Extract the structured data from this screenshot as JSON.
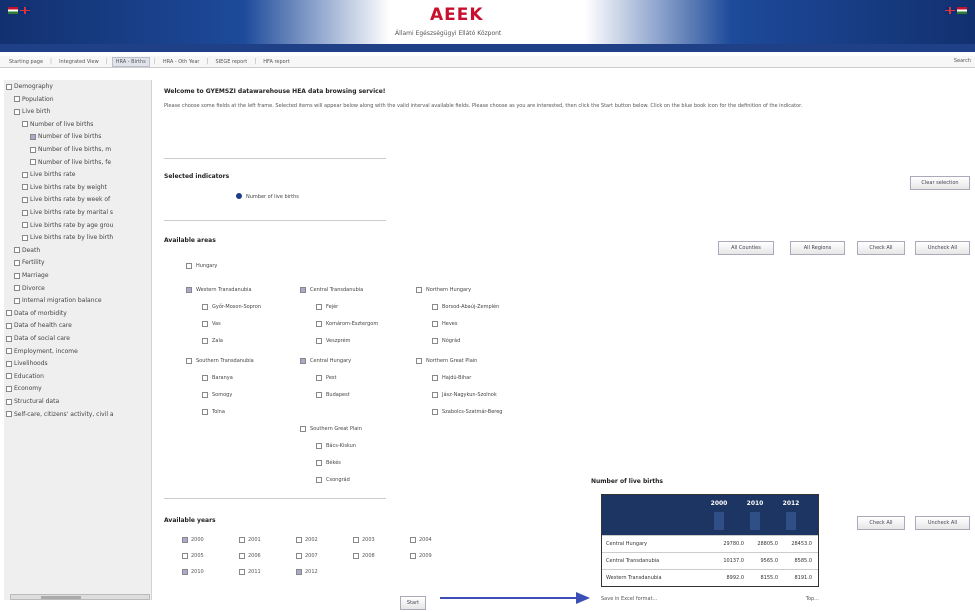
{
  "header": {
    "logo": "AEEK",
    "subtitle": "Állami Egészségügyi Ellátó Központ"
  },
  "nav": {
    "tabs": [
      "Starting page",
      "Integrated View",
      "HRA - Births",
      "HRA - Oth Year",
      "SIEGE report",
      "HFA report"
    ],
    "active_index": 2,
    "search": "Search"
  },
  "sidebar": {
    "items": [
      {
        "label": "Demography",
        "level": 0,
        "checked": false
      },
      {
        "label": "Population",
        "level": 1,
        "checked": false
      },
      {
        "label": "Live birth",
        "level": 1,
        "checked": false
      },
      {
        "label": "Number of live births",
        "level": 2,
        "checked": false
      },
      {
        "label": "Number of live births",
        "level": 3,
        "checked": true
      },
      {
        "label": "Number of live births, m",
        "level": 3,
        "checked": false
      },
      {
        "label": "Number of live births, fe",
        "level": 3,
        "checked": false
      },
      {
        "label": "Live births rate",
        "level": 2,
        "checked": false
      },
      {
        "label": "Live births rate by weight",
        "level": 2,
        "checked": false
      },
      {
        "label": "Live births rate by week of",
        "level": 2,
        "checked": false
      },
      {
        "label": "Live births rate by marital s",
        "level": 2,
        "checked": false
      },
      {
        "label": "Live births rate by age grou",
        "level": 2,
        "checked": false
      },
      {
        "label": "Live births rate by live birth",
        "level": 2,
        "checked": false
      },
      {
        "label": "Death",
        "level": 1,
        "checked": false
      },
      {
        "label": "Fertility",
        "level": 1,
        "checked": false
      },
      {
        "label": "Marriage",
        "level": 1,
        "checked": false
      },
      {
        "label": "Divorce",
        "level": 1,
        "checked": false
      },
      {
        "label": "Internal migration balance",
        "level": 1,
        "checked": false
      },
      {
        "label": "Data of morbidity",
        "level": 0,
        "checked": false
      },
      {
        "label": "Data of health care",
        "level": 0,
        "checked": false
      },
      {
        "label": "Data of social care",
        "level": 0,
        "checked": false
      },
      {
        "label": "Employment, income",
        "level": 0,
        "checked": false
      },
      {
        "label": "Livelihoods",
        "level": 0,
        "checked": false
      },
      {
        "label": "Education",
        "level": 0,
        "checked": false
      },
      {
        "label": "Economy",
        "level": 0,
        "checked": false
      },
      {
        "label": "Structural data",
        "level": 0,
        "checked": false
      },
      {
        "label": "Self-care, citizens' activity, civil a",
        "level": 0,
        "checked": false
      }
    ]
  },
  "main": {
    "title": "Welcome to GYEMSZI datawarehouse HEA data browsing service!",
    "intro": "Please choose some fields at the left frame. Selected items will appear below along with the valid interval available fields. Please choose as you are interested, then click the Start button below. Click on the blue book icon for the definition of the indicator.",
    "selected_indicators_label": "Selected indicators",
    "selected_indicator": "Number of live births",
    "clear_selection": "Clear selection",
    "available_areas_label": "Available areas",
    "area_buttons": [
      "All Counties",
      "All Regions",
      "Check All",
      "Uncheck All"
    ],
    "hungary": "Hungary",
    "regions": [
      {
        "name": "Western Transdanubia",
        "checked": true,
        "counties": [
          "Győr-Moson-Sopron",
          "Vas",
          "Zala"
        ]
      },
      {
        "name": "Central Transdanubia",
        "checked": true,
        "counties": [
          "Fejér",
          "Komárom-Esztergom",
          "Veszprém"
        ]
      },
      {
        "name": "Northern Hungary",
        "checked": false,
        "counties": [
          "Borsod-Abaúj-Zemplén",
          "Heves",
          "Nógrád"
        ]
      },
      {
        "name": "Southern Transdanubia",
        "checked": false,
        "counties": [
          "Baranya",
          "Somogy",
          "Tolna"
        ]
      },
      {
        "name": "Central Hungary",
        "checked": true,
        "counties": [
          "Pest",
          "Budapest"
        ]
      },
      {
        "name": "Northern Great Plain",
        "checked": false,
        "counties": [
          "Hajdú-Bihar",
          "Jász-Nagykun-Szolnok",
          "Szabolcs-Szatmár-Bereg"
        ]
      },
      {
        "name": "Southern Great Plain",
        "checked": false,
        "counties": [
          "Bács-Kiskun",
          "Békés",
          "Csongrád"
        ]
      }
    ],
    "available_years_label": "Available years",
    "years": [
      {
        "y": "2000",
        "checked": true
      },
      {
        "y": "2001",
        "checked": false
      },
      {
        "y": "2002",
        "checked": false
      },
      {
        "y": "2003",
        "checked": false
      },
      {
        "y": "2004",
        "checked": false
      },
      {
        "y": "2005",
        "checked": false
      },
      {
        "y": "2006",
        "checked": false
      },
      {
        "y": "2007",
        "checked": false
      },
      {
        "y": "2008",
        "checked": false
      },
      {
        "y": "2009",
        "checked": false
      },
      {
        "y": "2010",
        "checked": true
      },
      {
        "y": "2011",
        "checked": false
      },
      {
        "y": "2012",
        "checked": true
      }
    ],
    "year_buttons": [
      "Check All",
      "Uncheck All"
    ],
    "start_button": "Start",
    "result": {
      "title": "Number of live births",
      "years": [
        "2000",
        "2010",
        "2012"
      ],
      "rows": [
        {
          "label": "Central Hungary",
          "values": [
            "29780.0",
            "28805.0",
            "28453.0"
          ]
        },
        {
          "label": "Central Transdanubia",
          "values": [
            "10137.0",
            "9565.0",
            "8585.0"
          ]
        },
        {
          "label": "Western Transdanubia",
          "values": [
            "8992.0",
            "8155.0",
            "8191.0"
          ]
        }
      ],
      "footer_left": "Save in Excel format...",
      "footer_right": "Top..."
    }
  }
}
